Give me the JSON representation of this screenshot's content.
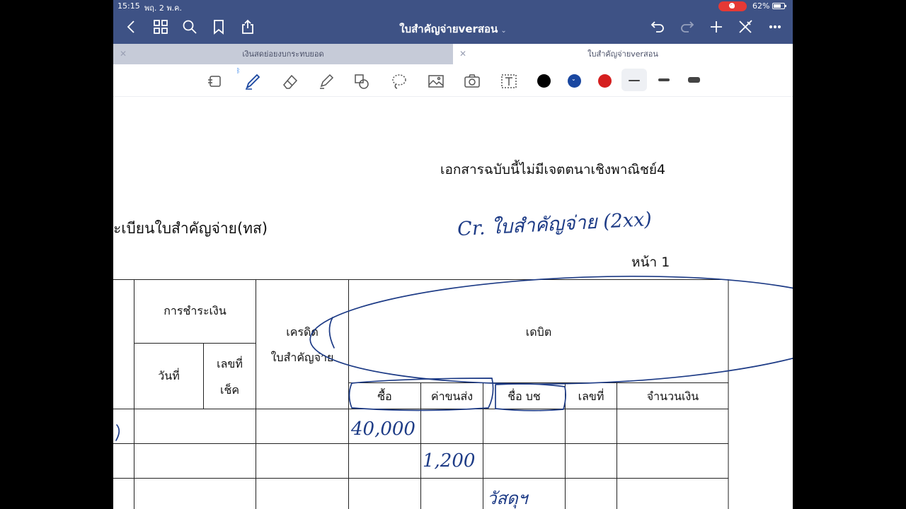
{
  "status": {
    "time": "15:15",
    "date": "พฤ. 2 พ.ค.",
    "battery": "62%"
  },
  "nav": {
    "title": "ใบสำคัญจ่ายverสอน"
  },
  "tabs": [
    {
      "label": "เงินสดย่อยงบกระทบยอด"
    },
    {
      "label": "ใบสำคัญจ่ายverสอน"
    }
  ],
  "toolbar": {
    "colors": [
      "#000000",
      "#1a47a0",
      "#d51f1f"
    ]
  },
  "document": {
    "disclaimer": "เอกสารฉบับนี้ไม่มีเจตตนาเชิงพาณิชย์4",
    "title": "ะเบียนใบสำคัญจ่าย(ทส)",
    "page": "หน้า 1",
    "table": {
      "payment": "การชำระเงิน",
      "date": "วันที่",
      "cheque_no_1": "เลขที่",
      "cheque_no_2": "เช็ค",
      "credit": "เครดิต",
      "voucher": "ใบสำคัญจ่าย",
      "debit": "เดบิต",
      "purchases": "ซื้อ",
      "freight": "ค่าขนส่ง",
      "account_name": "ชื่อ บช",
      "account_no": "เลขที่",
      "amount": "จำนวนเงิน"
    },
    "handwriting": {
      "cr_note": "Cr. ใบสำคัญจ่าย (2xx)",
      "row1_purchase": "40,000",
      "row2_freight": "1,200",
      "row3_note": "วัสดุฯ"
    }
  }
}
